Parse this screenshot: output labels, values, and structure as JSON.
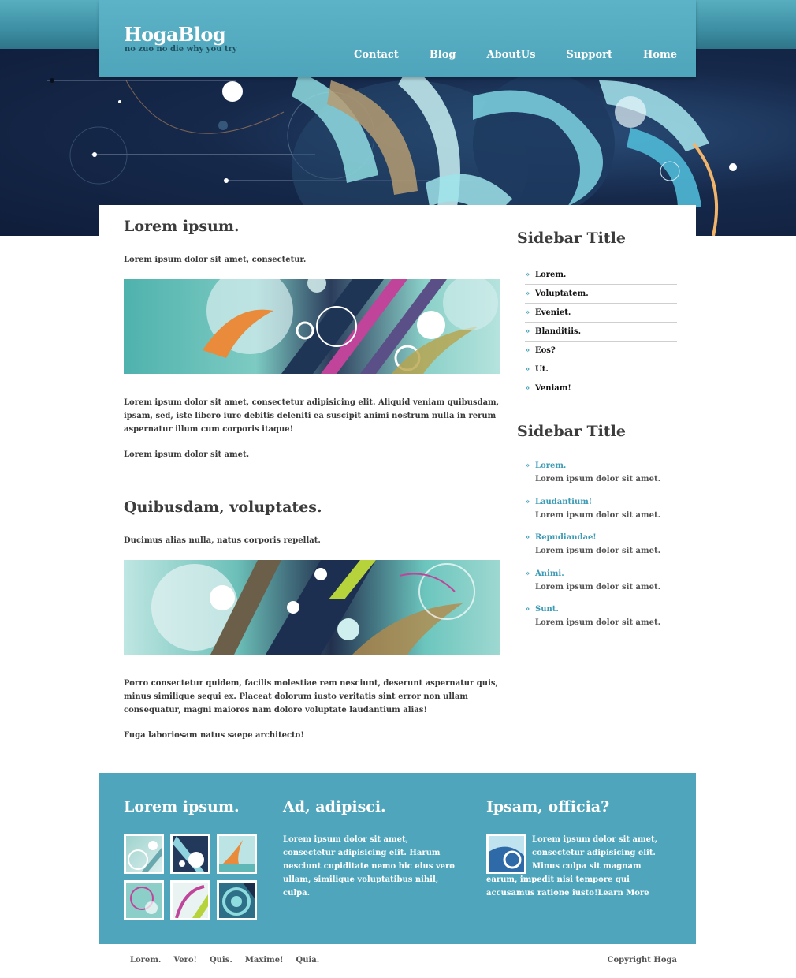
{
  "header": {
    "logo": "HogaBlog",
    "tagline": "no zuo no die why you try",
    "nav": [
      "Contact",
      "Blog",
      "AboutUs",
      "Support",
      "Home"
    ]
  },
  "main": {
    "post1": {
      "title": "Lorem ipsum.",
      "intro": "Lorem ipsum dolor sit amet, consectetur.",
      "body": "Lorem ipsum dolor sit amet, consectetur adipisicing elit. Aliquid veniam quibusdam, ipsam, sed, iste libero iure debitis deleniti ea suscipit animi nostrum nulla in rerum aspernatur illum cum corporis itaque!",
      "closing": "Lorem ipsum dolor sit amet."
    },
    "post2": {
      "title": "Quibusdam, voluptates.",
      "intro": "Ducimus alias nulla, natus corporis repellat.",
      "body": "Porro consectetur quidem, facilis molestiae rem nesciunt, deserunt aspernatur quis, minus similique sequi ex. Placeat dolorum iusto veritatis sint error non ullam consequatur, magni maiores nam dolore voluptate laudantium alias!",
      "closing": "Fuga laboriosam natus saepe architecto!"
    }
  },
  "sidebar": {
    "section1": {
      "title": "Sidebar Title",
      "items": [
        "Lorem.",
        "Voluptatem.",
        "Eveniet.",
        "Blanditiis.",
        "Eos?",
        "Ut.",
        "Veniam!"
      ]
    },
    "section2": {
      "title": "Sidebar Title",
      "items": [
        {
          "link": "Lorem.",
          "desc": "Lorem ipsum dolor sit amet."
        },
        {
          "link": "Laudantium!",
          "desc": "Lorem ipsum dolor sit amet."
        },
        {
          "link": "Repudiandae!",
          "desc": "Lorem ipsum dolor sit amet."
        },
        {
          "link": "Animi.",
          "desc": "Lorem ipsum dolor sit amet."
        },
        {
          "link": "Sunt.",
          "desc": "Lorem ipsum dolor sit amet."
        }
      ]
    },
    "chevron": "»"
  },
  "footer": {
    "col1_title": "Lorem ipsum.",
    "col2_title": "Ad, adipisci.",
    "col2_text": "Lorem ipsum dolor sit amet, consectetur adipisicing elit. Harum nesciunt cupiditate nemo hic eius vero ullam, similique voluptatibus nihil, culpa.",
    "col3_title": "Ipsam, officia?",
    "col3_text": "Lorem ipsum dolor sit amet, consectetur adipisicing elit. Minus culpa sit magnam earum, impedit nisi tempore qui accusamus ratione iusto!",
    "col3_link": "Learn More"
  },
  "bottom": {
    "links": [
      "Lorem.",
      "Vero!",
      "Quis.",
      "Maxime!",
      "Quia."
    ],
    "copyright": "Copyright Hoga"
  },
  "colors": {
    "accent": "#4fa6bc",
    "link": "#3d9bb5",
    "hero_dark": "#16294b"
  }
}
